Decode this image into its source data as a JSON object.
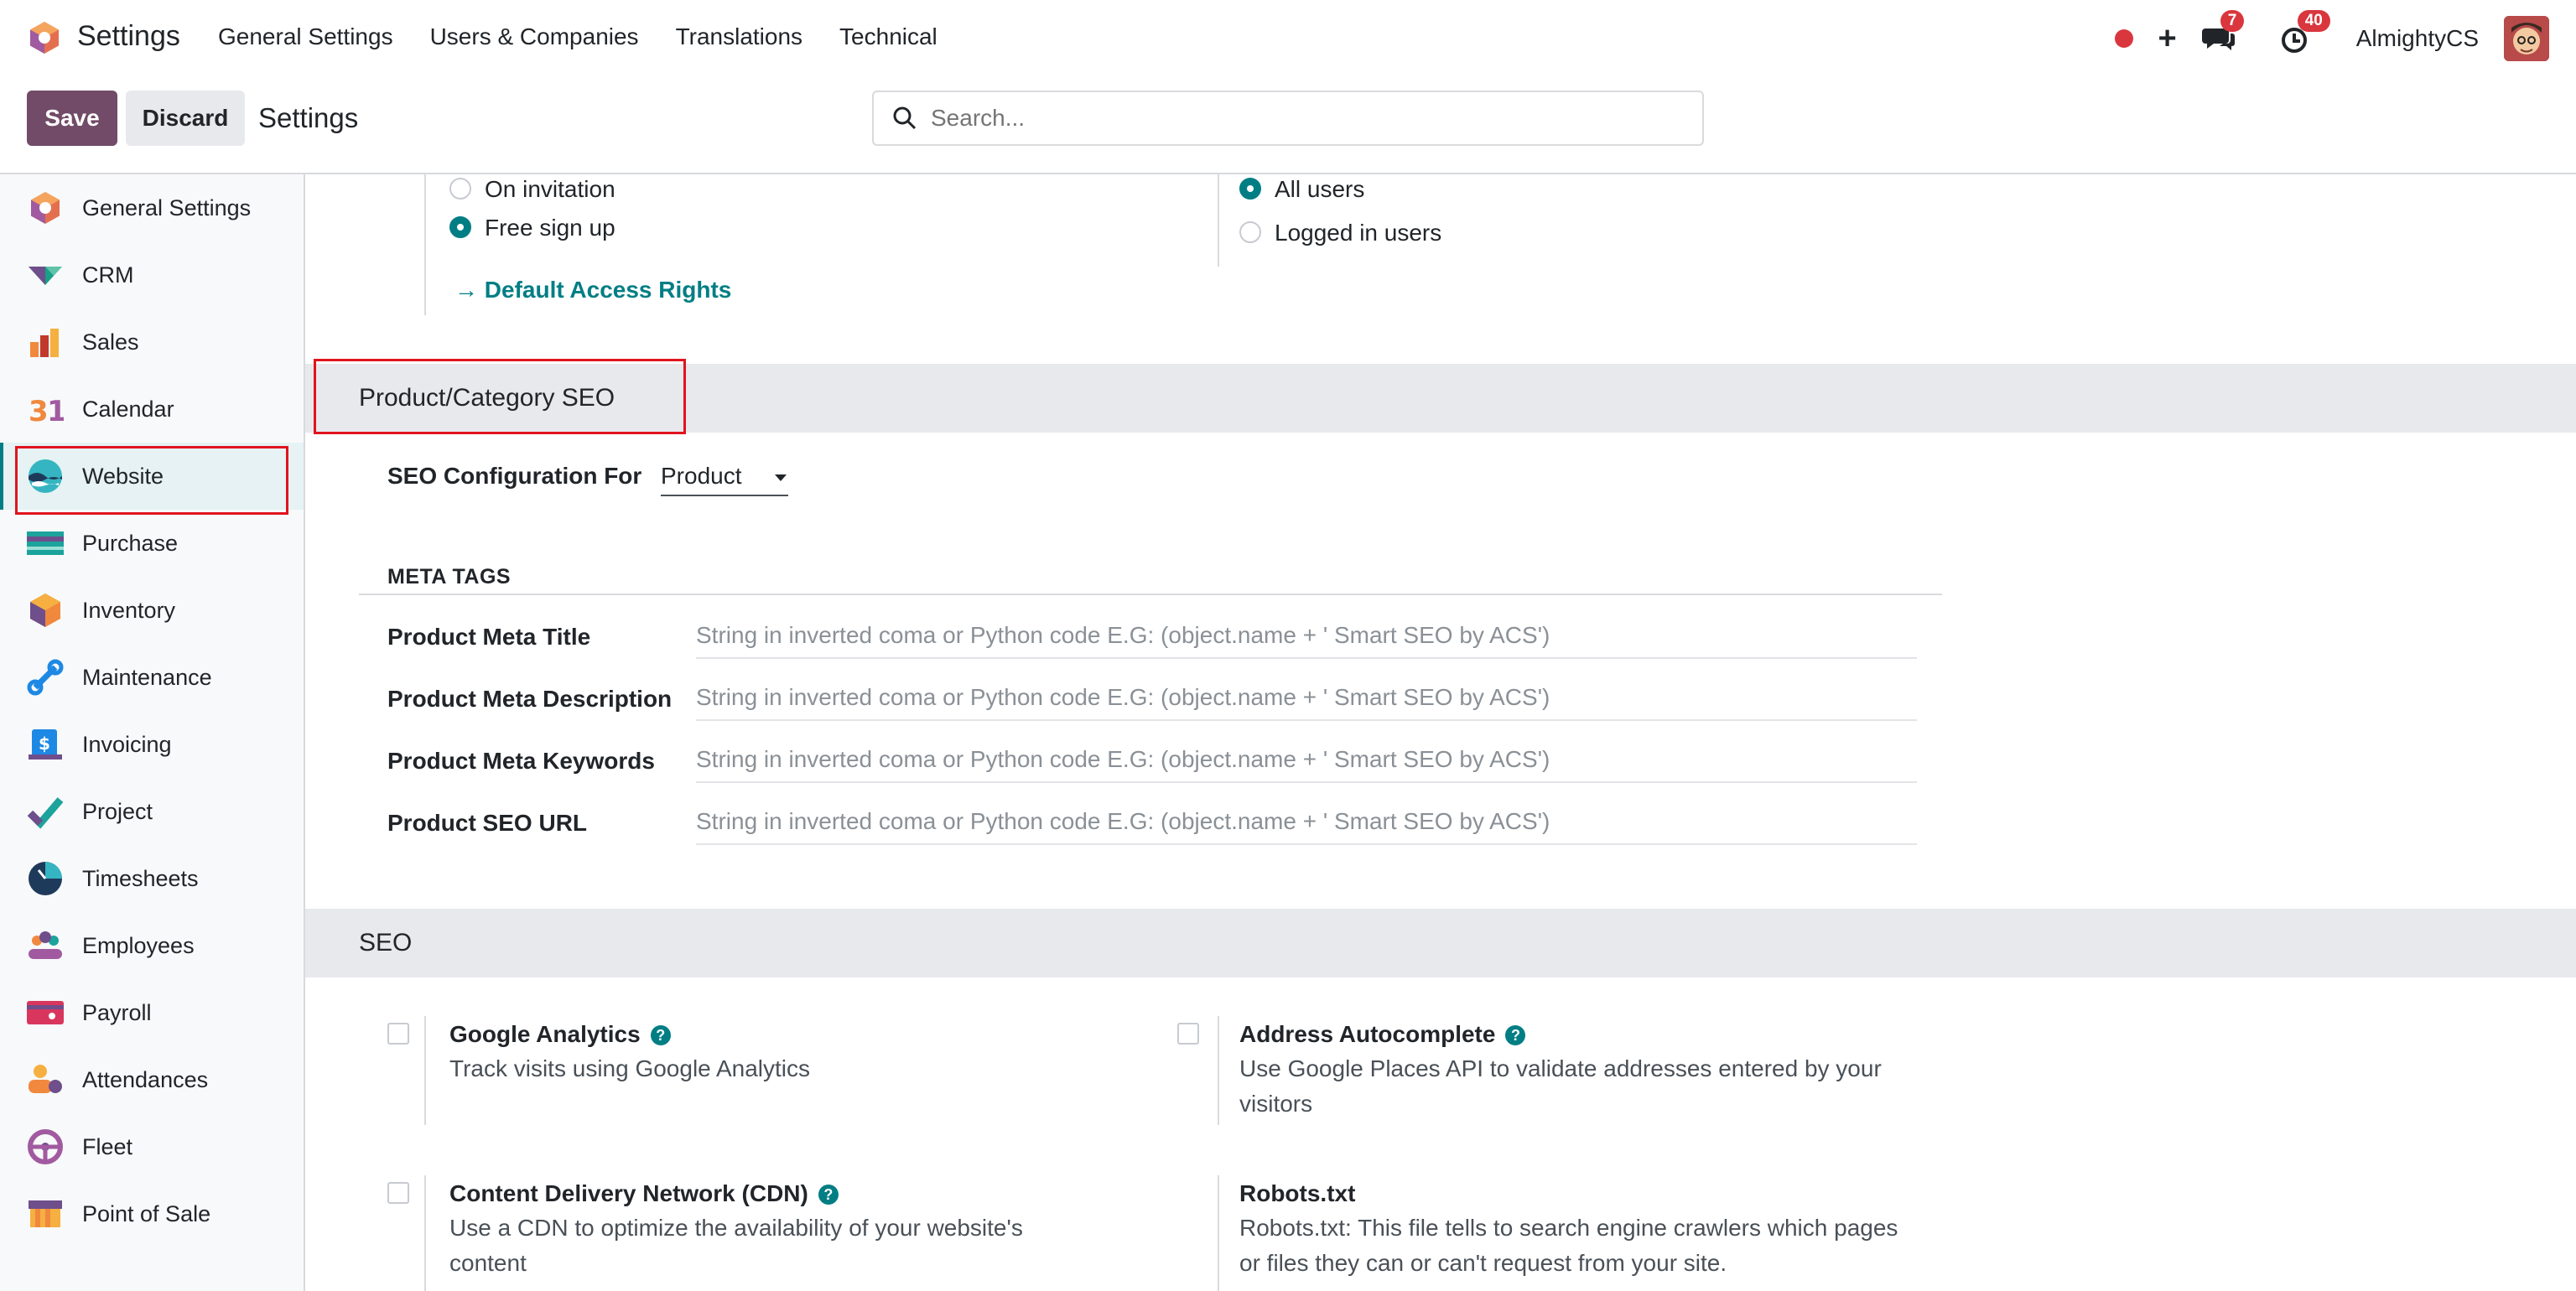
{
  "navbar": {
    "app_title": "Settings",
    "menu": [
      "General Settings",
      "Users & Companies",
      "Translations",
      "Technical"
    ],
    "messages_count": "7",
    "activities_count": "40",
    "user_name": "AlmightyCS"
  },
  "control_panel": {
    "save_label": "Save",
    "discard_label": "Discard",
    "breadcrumb": "Settings",
    "search_placeholder": "Search..."
  },
  "sidebar": {
    "items": [
      {
        "label": "General Settings"
      },
      {
        "label": "CRM"
      },
      {
        "label": "Sales"
      },
      {
        "label": "Calendar"
      },
      {
        "label": "Website"
      },
      {
        "label": "Purchase"
      },
      {
        "label": "Inventory"
      },
      {
        "label": "Maintenance"
      },
      {
        "label": "Invoicing"
      },
      {
        "label": "Project"
      },
      {
        "label": "Timesheets"
      },
      {
        "label": "Employees"
      },
      {
        "label": "Payroll"
      },
      {
        "label": "Attendances"
      },
      {
        "label": "Fleet"
      },
      {
        "label": "Point of Sale"
      }
    ],
    "active": "Website"
  },
  "signup": {
    "options": [
      "On invitation",
      "Free sign up"
    ],
    "selected": "Free sign up",
    "default_access_link": "Default Access Rights"
  },
  "visibility": {
    "options": [
      "All users",
      "Logged in users"
    ],
    "selected": "All users"
  },
  "product_seo": {
    "section_title": "Product/Category SEO",
    "config_label": "SEO Configuration For",
    "config_value": "Product",
    "meta_heading": "META TAGS",
    "fields": [
      {
        "label": "Product Meta Title",
        "placeholder": "String in inverted coma or Python code E.G: (object.name + ' Smart SEO by ACS')"
      },
      {
        "label": "Product Meta Description",
        "placeholder": "String in inverted coma or Python code E.G: (object.name + ' Smart SEO by ACS')"
      },
      {
        "label": "Product Meta Keywords",
        "placeholder": "String in inverted coma or Python code E.G: (object.name + ' Smart SEO by ACS')"
      },
      {
        "label": "Product SEO URL",
        "placeholder": "String in inverted coma or Python code E.G: (object.name + ' Smart SEO by ACS')"
      }
    ]
  },
  "seo": {
    "section_title": "SEO",
    "settings": [
      {
        "title": "Google Analytics",
        "desc": "Track visits using Google Analytics",
        "checked": false
      },
      {
        "title": "Address Autocomplete",
        "desc": "Use Google Places API to validate addresses entered by your visitors",
        "checked": false
      },
      {
        "title": "Content Delivery Network (CDN)",
        "desc": "Use a CDN to optimize the availability of your website's content",
        "checked": false
      },
      {
        "title": "Robots.txt",
        "desc": "Robots.txt: This file tells to search engine crawlers which pages or files they can or can't request from your site."
      }
    ]
  },
  "colors": {
    "brand_primary": "#714b67",
    "accent_teal": "#017e84",
    "highlight_red": "#e0141e",
    "badge_red": "#d9363e"
  }
}
